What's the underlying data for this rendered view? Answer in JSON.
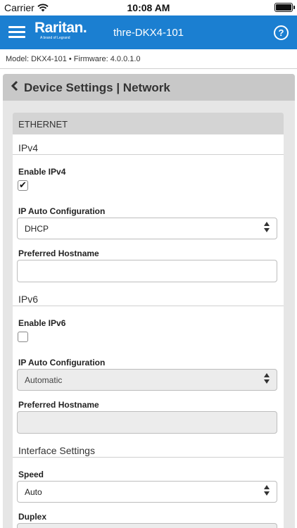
{
  "status_bar": {
    "carrier": "Carrier",
    "time": "10:08 AM"
  },
  "header": {
    "brand": "Raritan.",
    "brand_tagline": "A brand of Legrand",
    "device_name": "thre-DKX4-101",
    "help_label": "?"
  },
  "device_info": {
    "text": "Model: DKX4-101  •  Firmware: 4.0.0.1.0"
  },
  "page": {
    "title": "Device Settings | Network"
  },
  "ethernet": {
    "header": "ETHERNET",
    "ipv4": {
      "section_title": "IPv4",
      "enable_label": "Enable IPv4",
      "enabled": true,
      "auto_config_label": "IP Auto Configuration",
      "auto_config_value": "DHCP",
      "hostname_label": "Preferred Hostname",
      "hostname_value": ""
    },
    "ipv6": {
      "section_title": "IPv6",
      "enable_label": "Enable IPv6",
      "enabled": false,
      "auto_config_label": "IP Auto Configuration",
      "auto_config_value": "Automatic",
      "hostname_label": "Preferred Hostname",
      "hostname_value": ""
    },
    "interface": {
      "section_title": "Interface Settings",
      "speed_label": "Speed",
      "speed_value": "Auto",
      "duplex_label": "Duplex"
    }
  },
  "colors": {
    "header_bg": "#1b7fd1",
    "panel_bg": "#e6e6e6",
    "panel_header_bg": "#c8c8c8"
  },
  "icons": {
    "menu": "menu-icon",
    "help": "help-icon",
    "back": "chevron-left-icon",
    "select": "updown-arrows-icon",
    "wifi": "wifi-icon",
    "battery": "battery-icon"
  }
}
